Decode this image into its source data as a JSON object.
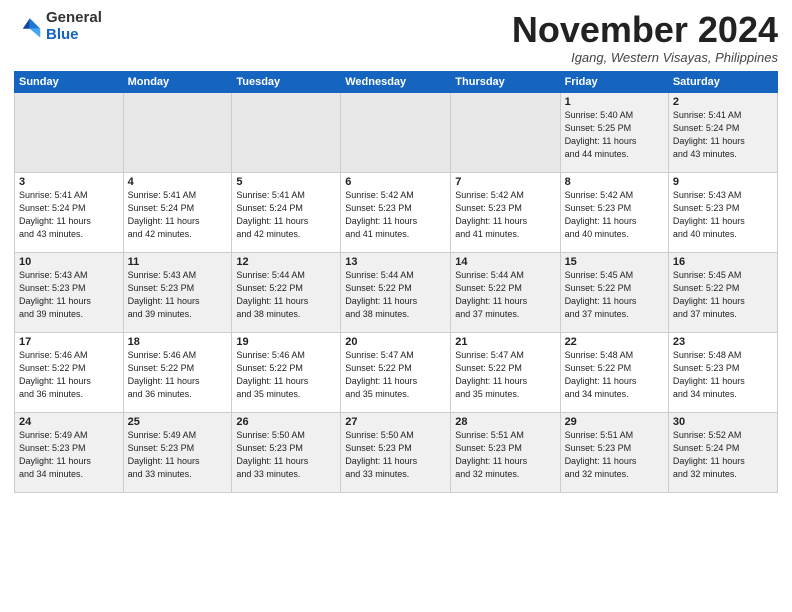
{
  "logo": {
    "general": "General",
    "blue": "Blue"
  },
  "header": {
    "month": "November 2024",
    "location": "Igang, Western Visayas, Philippines"
  },
  "weekdays": [
    "Sunday",
    "Monday",
    "Tuesday",
    "Wednesday",
    "Thursday",
    "Friday",
    "Saturday"
  ],
  "weeks": [
    [
      {
        "day": "",
        "info": ""
      },
      {
        "day": "",
        "info": ""
      },
      {
        "day": "",
        "info": ""
      },
      {
        "day": "",
        "info": ""
      },
      {
        "day": "",
        "info": ""
      },
      {
        "day": "1",
        "info": "Sunrise: 5:40 AM\nSunset: 5:25 PM\nDaylight: 11 hours\nand 44 minutes."
      },
      {
        "day": "2",
        "info": "Sunrise: 5:41 AM\nSunset: 5:24 PM\nDaylight: 11 hours\nand 43 minutes."
      }
    ],
    [
      {
        "day": "3",
        "info": "Sunrise: 5:41 AM\nSunset: 5:24 PM\nDaylight: 11 hours\nand 43 minutes."
      },
      {
        "day": "4",
        "info": "Sunrise: 5:41 AM\nSunset: 5:24 PM\nDaylight: 11 hours\nand 42 minutes."
      },
      {
        "day": "5",
        "info": "Sunrise: 5:41 AM\nSunset: 5:24 PM\nDaylight: 11 hours\nand 42 minutes."
      },
      {
        "day": "6",
        "info": "Sunrise: 5:42 AM\nSunset: 5:23 PM\nDaylight: 11 hours\nand 41 minutes."
      },
      {
        "day": "7",
        "info": "Sunrise: 5:42 AM\nSunset: 5:23 PM\nDaylight: 11 hours\nand 41 minutes."
      },
      {
        "day": "8",
        "info": "Sunrise: 5:42 AM\nSunset: 5:23 PM\nDaylight: 11 hours\nand 40 minutes."
      },
      {
        "day": "9",
        "info": "Sunrise: 5:43 AM\nSunset: 5:23 PM\nDaylight: 11 hours\nand 40 minutes."
      }
    ],
    [
      {
        "day": "10",
        "info": "Sunrise: 5:43 AM\nSunset: 5:23 PM\nDaylight: 11 hours\nand 39 minutes."
      },
      {
        "day": "11",
        "info": "Sunrise: 5:43 AM\nSunset: 5:23 PM\nDaylight: 11 hours\nand 39 minutes."
      },
      {
        "day": "12",
        "info": "Sunrise: 5:44 AM\nSunset: 5:22 PM\nDaylight: 11 hours\nand 38 minutes."
      },
      {
        "day": "13",
        "info": "Sunrise: 5:44 AM\nSunset: 5:22 PM\nDaylight: 11 hours\nand 38 minutes."
      },
      {
        "day": "14",
        "info": "Sunrise: 5:44 AM\nSunset: 5:22 PM\nDaylight: 11 hours\nand 37 minutes."
      },
      {
        "day": "15",
        "info": "Sunrise: 5:45 AM\nSunset: 5:22 PM\nDaylight: 11 hours\nand 37 minutes."
      },
      {
        "day": "16",
        "info": "Sunrise: 5:45 AM\nSunset: 5:22 PM\nDaylight: 11 hours\nand 37 minutes."
      }
    ],
    [
      {
        "day": "17",
        "info": "Sunrise: 5:46 AM\nSunset: 5:22 PM\nDaylight: 11 hours\nand 36 minutes."
      },
      {
        "day": "18",
        "info": "Sunrise: 5:46 AM\nSunset: 5:22 PM\nDaylight: 11 hours\nand 36 minutes."
      },
      {
        "day": "19",
        "info": "Sunrise: 5:46 AM\nSunset: 5:22 PM\nDaylight: 11 hours\nand 35 minutes."
      },
      {
        "day": "20",
        "info": "Sunrise: 5:47 AM\nSunset: 5:22 PM\nDaylight: 11 hours\nand 35 minutes."
      },
      {
        "day": "21",
        "info": "Sunrise: 5:47 AM\nSunset: 5:22 PM\nDaylight: 11 hours\nand 35 minutes."
      },
      {
        "day": "22",
        "info": "Sunrise: 5:48 AM\nSunset: 5:22 PM\nDaylight: 11 hours\nand 34 minutes."
      },
      {
        "day": "23",
        "info": "Sunrise: 5:48 AM\nSunset: 5:23 PM\nDaylight: 11 hours\nand 34 minutes."
      }
    ],
    [
      {
        "day": "24",
        "info": "Sunrise: 5:49 AM\nSunset: 5:23 PM\nDaylight: 11 hours\nand 34 minutes."
      },
      {
        "day": "25",
        "info": "Sunrise: 5:49 AM\nSunset: 5:23 PM\nDaylight: 11 hours\nand 33 minutes."
      },
      {
        "day": "26",
        "info": "Sunrise: 5:50 AM\nSunset: 5:23 PM\nDaylight: 11 hours\nand 33 minutes."
      },
      {
        "day": "27",
        "info": "Sunrise: 5:50 AM\nSunset: 5:23 PM\nDaylight: 11 hours\nand 33 minutes."
      },
      {
        "day": "28",
        "info": "Sunrise: 5:51 AM\nSunset: 5:23 PM\nDaylight: 11 hours\nand 32 minutes."
      },
      {
        "day": "29",
        "info": "Sunrise: 5:51 AM\nSunset: 5:23 PM\nDaylight: 11 hours\nand 32 minutes."
      },
      {
        "day": "30",
        "info": "Sunrise: 5:52 AM\nSunset: 5:24 PM\nDaylight: 11 hours\nand 32 minutes."
      }
    ]
  ]
}
